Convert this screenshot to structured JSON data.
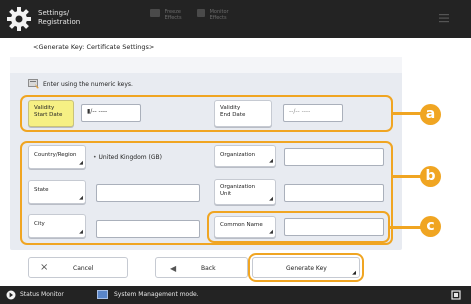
{
  "header": {
    "title_line1": "Settings/",
    "title_line2": "Registration",
    "btn1_line1": "Freeze",
    "btn1_line2": "Effects",
    "btn2_line1": "Monitor",
    "btn2_line2": "Effects"
  },
  "breadcrumb": "<Generate Key: Certificate Settings>",
  "hint": "Enter using the numeric keys.",
  "validity": {
    "start_label_1": "Validity",
    "start_label_2": "Start Date",
    "start_value": "▮/-- ----",
    "end_label_1": "Validity",
    "end_label_2": "End Date",
    "end_value": "--/-- ----"
  },
  "fields": {
    "country_label": "Country/Region",
    "country_value": "United Kingdom (GB)",
    "organization_label": "Organization",
    "state_label": "State",
    "org_unit_label_1": "Organization",
    "org_unit_label_2": "Unit",
    "city_label": "City",
    "common_name_label": "Common Name"
  },
  "callouts": {
    "a": "a",
    "b": "b",
    "c": "c"
  },
  "buttons": {
    "cancel": "Cancel",
    "back": "Back",
    "generate": "Generate Key"
  },
  "statusbar": {
    "status_monitor": "Status Monitor",
    "system_mode": "System Management mode."
  },
  "colors": {
    "accent": "#f0a522",
    "selected": "#f6f084",
    "header_bg": "#232323"
  }
}
